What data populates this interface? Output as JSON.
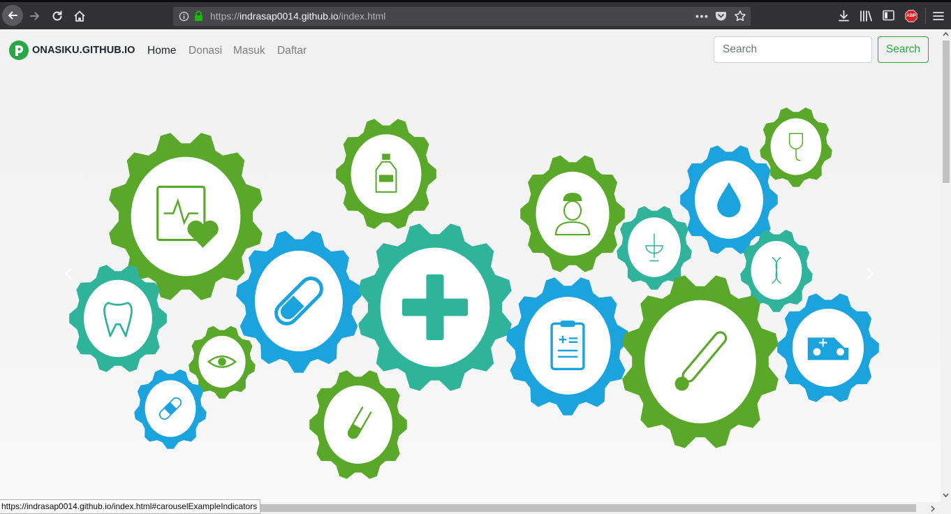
{
  "browser": {
    "url": {
      "scheme": "https://",
      "host": "indrasap0014.github.io",
      "path": "/index.html"
    },
    "status_url": "https://indrasap0014.github.io/index.html#carouselExampleIndicators",
    "icons": [
      "back-icon",
      "forward-icon",
      "reload-icon",
      "home-icon",
      "info-icon",
      "lock-icon",
      "more-icon",
      "pocket-icon",
      "bookmark-star-icon",
      "download-icon",
      "library-icon",
      "sidebar-icon",
      "adblock-icon",
      "menu-icon"
    ],
    "adblock_label": "ABP"
  },
  "navbar": {
    "brand": "ONASIKU.GITHUB.IO",
    "links": [
      {
        "label": "Home",
        "active": true
      },
      {
        "label": "Donasi",
        "active": false
      },
      {
        "label": "Masuk",
        "active": false
      },
      {
        "label": "Daftar",
        "active": false
      }
    ],
    "search": {
      "placeholder": "Search",
      "button_label": "Search"
    },
    "accent_color": "#28a745"
  },
  "carousel": {
    "id": "carouselExampleIndicators",
    "prev_icon": "chevron-left-icon",
    "next_icon": "chevron-right-icon",
    "gear_colors": {
      "green": "#5aa82a",
      "teal": "#2fb39a",
      "blue": "#1aa3dc"
    },
    "gear_icons": [
      "heart-monitor-icon",
      "medicine-bottle-icon",
      "nurse-icon",
      "iv-drip-icon",
      "water-drop-icon",
      "pill-icon",
      "medical-cross-icon",
      "caduceus-icon",
      "dna-icon",
      "tooth-icon",
      "eye-icon",
      "clipboard-icon",
      "thermometer-icon",
      "ambulance-icon",
      "bandage-icon",
      "test-tube-icon"
    ]
  }
}
